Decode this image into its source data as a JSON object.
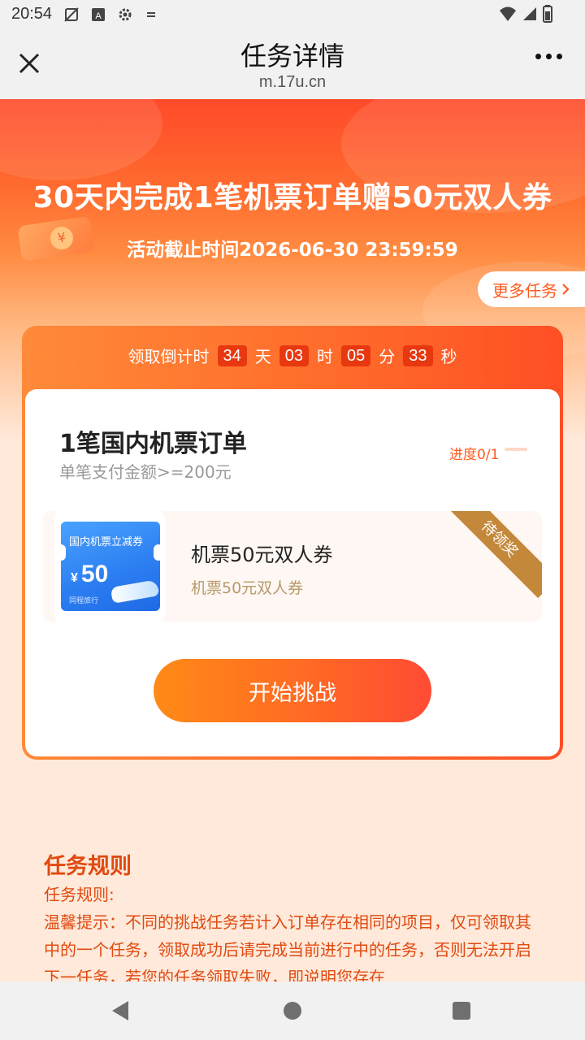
{
  "status_bar": {
    "time": "20:54",
    "icons": [
      "no-image-icon",
      "text-box-icon",
      "gear-icon",
      "sync-icon"
    ],
    "right_icons": [
      "wifi-icon",
      "signal-icon",
      "battery-icon"
    ]
  },
  "navbar": {
    "title": "任务详情",
    "url": "m.17u.cn"
  },
  "hero": {
    "title": "30天内完成1笔机票订单赠50元双人券",
    "deadline": "活动截止时间2026-06-30 23:59:59",
    "more_tasks": "更多任务"
  },
  "countdown": {
    "label": "领取倒计时",
    "days": "34",
    "days_unit": "天",
    "hours": "03",
    "hours_unit": "时",
    "minutes": "05",
    "minutes_unit": "分",
    "seconds": "33",
    "seconds_unit": "秒"
  },
  "task": {
    "title": "1笔国内机票订单",
    "subtitle": "单笔支付金额>=200元",
    "progress_label": "进度0/1",
    "progress_fraction": 0
  },
  "reward": {
    "ticket_title": "国内机票立减券",
    "ticket_currency": "¥",
    "ticket_value": "50",
    "ticket_brand": "同程旅行",
    "name": "机票50元双人券",
    "description": "机票50元双人券",
    "ribbon": "待领奖"
  },
  "actions": {
    "start_label": "开始挑战"
  },
  "rules": {
    "heading": "任务规则",
    "line1": "任务规则:",
    "body": "温馨提示：不同的挑战任务若计入订单存在相同的项目，仅可领取其中的一个任务，领取成功后请完成当前进行中的任务，否则无法开启下一任务，若您的任务领取失败，即说明您存在"
  },
  "colors": {
    "accent": "#ff5a1f",
    "rules_text": "#e04a10",
    "ribbon": "#c4883a",
    "countdown_box": "#e8380f"
  }
}
